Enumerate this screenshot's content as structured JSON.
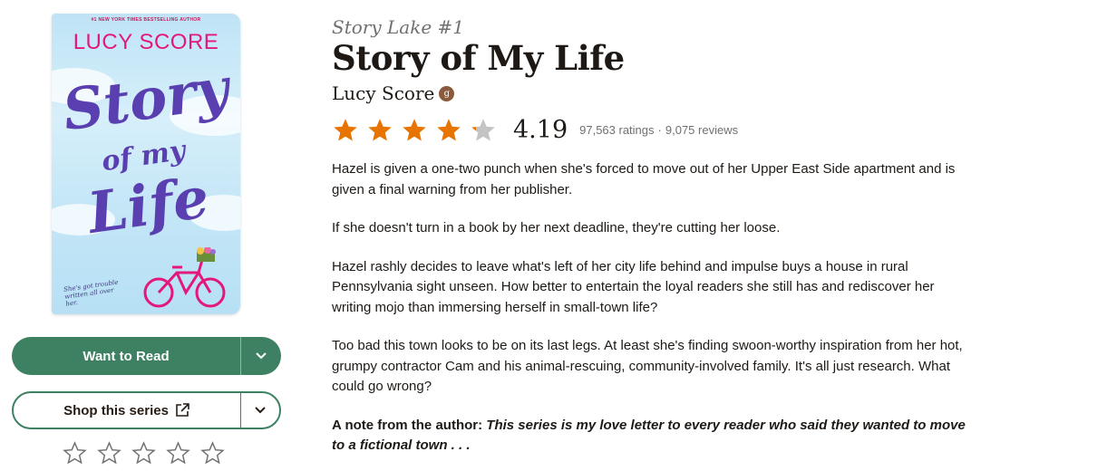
{
  "cover": {
    "tagline": "#1 NEW YORK TIMES BESTSELLING AUTHOR",
    "author": "LUCY SCORE",
    "title_line1": "Story",
    "title_line2": "of my",
    "title_line3": "Life",
    "blurb": "She's got trouble written all over her."
  },
  "actions": {
    "want_to_read": "Want to Read",
    "shop_series": "Shop this series",
    "rate_stars": 5
  },
  "book": {
    "series": "Story Lake #1",
    "title": "Story of My Life",
    "author": "Lucy Score",
    "author_badge": "g",
    "average_rating": "4.19",
    "rating_value": 4.19,
    "ratings_count": "97,563 ratings",
    "separator": "·",
    "reviews_count": "9,075 reviews"
  },
  "description": {
    "p1": "Hazel is given a one-two punch when she's forced to move out of her Upper East Side apartment and is given a final warning from her publisher.",
    "p2": "If she doesn't turn in a book by her next deadline, they're cutting her loose.",
    "p3": "Hazel rashly decides to leave what's left of her city life behind and impulse buys a house in rural Pennsylvania sight unseen. How better to entertain the loyal readers she still has and rediscover her writing mojo than immersing herself in small-town life?",
    "p4": "Too bad this town looks to be on its last legs. At least she's finding swoon-worthy inspiration from her hot, grumpy contractor Cam and his animal-rescuing, community-involved family. It's all just research. What could go wrong?",
    "note_label": "A note from the author:",
    "note_text": "This series is my love letter to every reader who said they wanted to move to a fictional town . . ."
  },
  "colors": {
    "star_filled": "#e87400",
    "star_empty": "#c4c4c4",
    "primary_green": "#3d8062"
  },
  "icons": {
    "dropdown": "chevron-down-icon",
    "external": "external-link-icon",
    "star": "star-icon"
  }
}
